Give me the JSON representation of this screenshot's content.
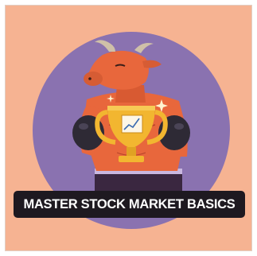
{
  "card": {
    "title": "MASTER STOCK MARKET BASICS"
  },
  "illustration": {
    "subject": "bull-boxer-holding-trophy",
    "icons": [
      "bull-icon",
      "trophy-icon",
      "rising-chart-icon",
      "boxing-glove-icon"
    ]
  },
  "colors": {
    "background": "#f6b392",
    "circle": "#8a72b0",
    "bull_skin": "#e8673c",
    "trophy_gold": "#f2b630",
    "gloves": "#2e2a35",
    "banner": "#1e1920",
    "banner_text": "#ffffff"
  }
}
